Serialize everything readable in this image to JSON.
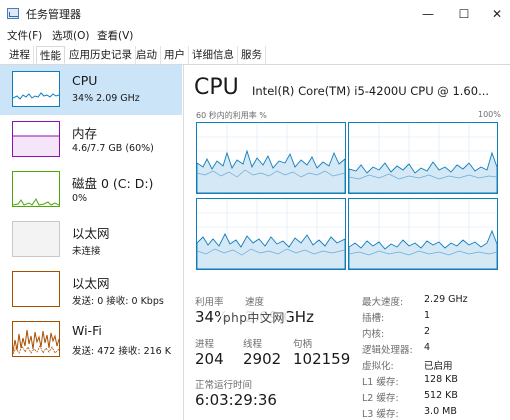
{
  "window": {
    "title": "任务管理器",
    "minimize": "—",
    "maximize": "☐",
    "close": "✕"
  },
  "menu": [
    "文件(F)",
    "选项(O)",
    "查看(V)"
  ],
  "tabs": [
    "进程",
    "性能",
    "应用历史记录",
    "启动",
    "用户",
    "详细信息",
    "服务"
  ],
  "sidebar": [
    {
      "title": "CPU",
      "sub": "34% 2.09 GHz",
      "color": "#117dbb"
    },
    {
      "title": "内存",
      "sub": "4.6/7.7 GB (60%)",
      "color": "#8b12ae"
    },
    {
      "title": "磁盘 0 (C: D:)",
      "sub": "0%",
      "color": "#4da60c"
    },
    {
      "title": "以太网",
      "sub": "未连接",
      "color": "#a0a0a0"
    },
    {
      "title": "以太网",
      "sub": "发送: 0 接收: 0 Kbps",
      "color": "#a74f01"
    },
    {
      "title": "Wi-Fi",
      "sub": "发送: 472 接收: 216 K",
      "color": "#a74f01"
    }
  ],
  "main": {
    "heading": "CPU",
    "model": "Intel(R) Core(TM) i5-4200U CPU @ 1.60...",
    "graph_label": "60 秒内的利用率 %",
    "graph_max": "100%",
    "utilization_label": "利用率",
    "utilization": "34%",
    "speed_label": "速度",
    "speed": "2.09 GHz",
    "processes_label": "进程",
    "processes": "204",
    "threads_label": "线程",
    "threads": "2902",
    "handles_label": "句柄",
    "handles": "102159",
    "uptime_label": "正常运行时间",
    "uptime": "6:03:29:36",
    "specs": [
      {
        "label": "最大速度:",
        "value": "2.29 GHz"
      },
      {
        "label": "插槽:",
        "value": "1"
      },
      {
        "label": "内核:",
        "value": "2"
      },
      {
        "label": "逻辑处理器:",
        "value": "4"
      },
      {
        "label": "虚拟化:",
        "value": "已启用"
      },
      {
        "label": "L1 缓存:",
        "value": "128 KB"
      },
      {
        "label": "L2 缓存:",
        "value": "512 KB"
      },
      {
        "label": "L3 缓存:",
        "value": "3.0 MB"
      }
    ]
  },
  "watermark": "php中文网"
}
